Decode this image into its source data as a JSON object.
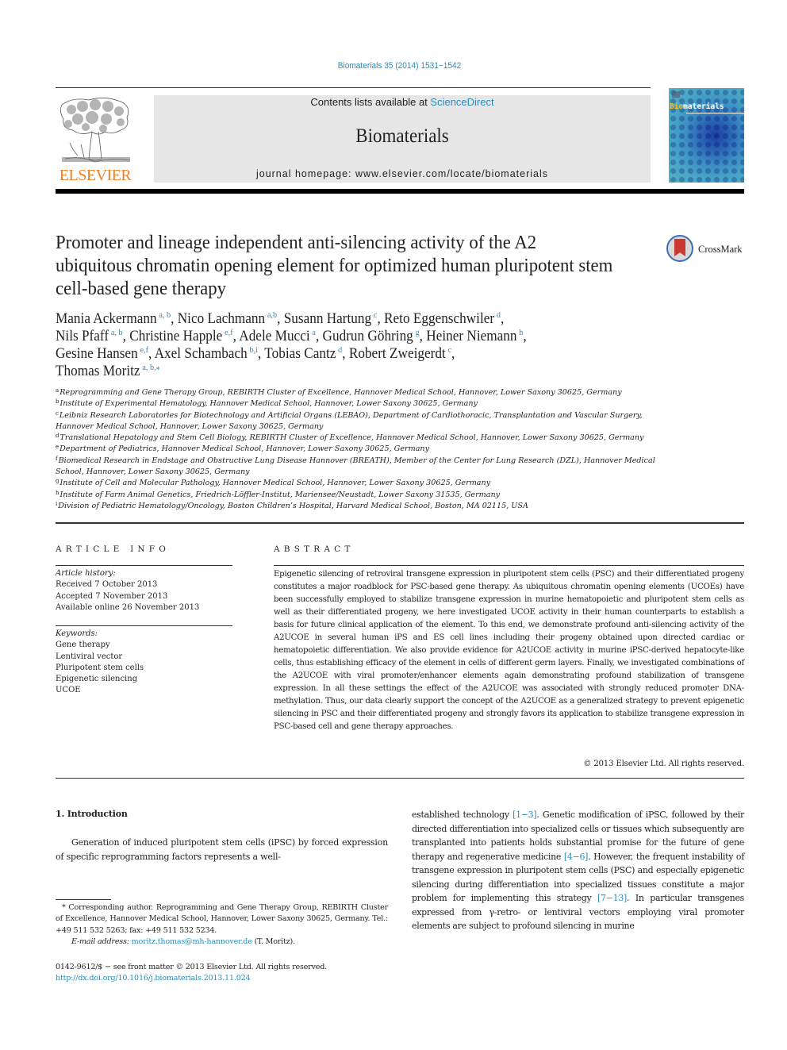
{
  "header": {
    "journal_reference": "Biomaterials 35 (2014) 1531−1542",
    "contents_prefix": "Contents lists available at ",
    "contents_link": "ScienceDirect",
    "journal_title": "Biomaterials",
    "homepage": "journal homepage: www.elsevier.com/locate/biomaterials",
    "publisher_logo_text": "ELSEVIER",
    "cover": {
      "title_highlight": "Bio",
      "title_rest": "materials"
    },
    "colors": {
      "link": "#2a8cba",
      "elsevier_orange": "#f47f20",
      "banner_bg": "#e6e6e6"
    }
  },
  "article": {
    "title": "Promoter and lineage independent anti-silencing activity of the A2 ubiquitous chromatin opening element for optimized human pluripotent stem cell-based gene therapy",
    "crossmark_label": "CrossMark",
    "authors": [
      {
        "name": "Mania Ackermann",
        "affils": "a, b",
        "sep": ", "
      },
      {
        "name": "Nico Lachmann",
        "affils": "a,b",
        "sep": ", "
      },
      {
        "name": "Susann Hartung",
        "affils": "c",
        "sep": ", "
      },
      {
        "name": "Reto Eggenschwiler",
        "affils": "d",
        "sep": ","
      },
      {
        "name": "Nils Pfaff",
        "affils": "a, b",
        "sep": ", "
      },
      {
        "name": "Christine Happle",
        "affils": "e,f",
        "sep": ", "
      },
      {
        "name": "Adele Mucci",
        "affils": "a",
        "sep": ", "
      },
      {
        "name": "Gudrun Göhring",
        "affils": "g",
        "sep": ", "
      },
      {
        "name": "Heiner Niemann",
        "affils": "h",
        "sep": ","
      },
      {
        "name": "Gesine Hansen",
        "affils": "e,f",
        "sep": ", "
      },
      {
        "name": "Axel Schambach",
        "affils": "b,i",
        "sep": ", "
      },
      {
        "name": "Tobias Cantz",
        "affils": "d",
        "sep": ", "
      },
      {
        "name": "Robert Zweigerdt",
        "affils": "c",
        "sep": ","
      },
      {
        "name": "Thomas Moritz",
        "affils": "a, b,⁎",
        "sep": ""
      }
    ],
    "affiliations": [
      {
        "key": "a",
        "text": "Reprogramming and Gene Therapy Group, REBIRTH Cluster of Excellence, Hannover Medical School, Hannover, Lower Saxony 30625, Germany"
      },
      {
        "key": "b",
        "text": "Institute of Experimental Hematology, Hannover Medical School, Hannover, Lower Saxony 30625, Germany"
      },
      {
        "key": "c",
        "text": "Leibniz Research Laboratories for Biotechnology and Artificial Organs (LEBAO), Department of Cardiothoracic, Transplantation and Vascular Surgery, Hannover Medical School, Hannover, Lower Saxony 30625, Germany"
      },
      {
        "key": "d",
        "text": "Translational Hepatology and Stem Cell Biology, REBIRTH Cluster of Excellence, Hannover Medical School, Hannover, Lower Saxony 30625, Germany"
      },
      {
        "key": "e",
        "text": "Department of Pediatrics, Hannover Medical School, Hannover, Lower Saxony 30625, Germany"
      },
      {
        "key": "f",
        "text": "Biomedical Research in Endstage and Obstructive Lung Disease Hannover (BREATH), Member of the Center for Lung Research (DZL), Hannover Medical School, Hannover, Lower Saxony 30625, Germany"
      },
      {
        "key": "g",
        "text": "Institute of Cell and Molecular Pathology, Hannover Medical School, Hannover, Lower Saxony 30625, Germany"
      },
      {
        "key": "h",
        "text": "Institute of Farm Animal Genetics, Friedrich-Löffler-Institut, Mariensee/Neustadt, Lower Saxony 31535, Germany"
      },
      {
        "key": "i",
        "text": "Division of Pediatric Hematology/Oncology, Boston Children’s Hospital, Harvard Medical School, Boston, MA 02115, USA"
      }
    ]
  },
  "article_info": {
    "heading": "ARTICLE INFO",
    "history_label": "Article history:",
    "received": "Received 7 October 2013",
    "accepted": "Accepted 7 November 2013",
    "available": "Available online 26 November 2013",
    "keywords_label": "Keywords:",
    "keywords": [
      "Gene therapy",
      "Lentiviral vector",
      "Pluripotent stem cells",
      "Epigenetic silencing",
      "UCOE"
    ]
  },
  "abstract": {
    "heading": "ABSTRACT",
    "text": "Epigenetic silencing of retroviral transgene expression in pluripotent stem cells (PSC) and their differ­entiated progeny constitutes a major roadblock for PSC-based gene therapy. As ubiquitous chromatin opening elements (UCOEs) have been successfully employed to stabilize transgene expression in murine hematopoietic and pluripotent stem cells as well as their differentiated progeny, we here investigated UCOE activity in their human counterparts to establish a basis for future clinical application of the element. To this end, we demonstrate profound anti-silencing activity of the A2UCOE in several human iPS and ES cell lines including their progeny obtained upon directed cardiac or hematopoietic differ­entiation. We also provide evidence for A2UCOE activity in murine iPSC-derived hepatocyte-like cells, thus establishing efficacy of the element in cells of different germ layers. Finally, we investigated com­binations of the A2UCOE with viral promoter/enhancer elements again demonstrating profound stabi­lization of transgene expression. In all these settings the effect of the A2UCOE was associated with strongly reduced promoter DNA-methylation. Thus, our data clearly support the concept of the A2UCOE as a generalized strategy to prevent epigenetic silencing in PSC and their differentiated progeny and strongly favors its application to stabilize transgene expression in PSC-based cell and gene therapy approaches.",
    "copyright": "© 2013 Elsevier Ltd. All rights reserved."
  },
  "body": {
    "section_heading": "1.  Introduction",
    "left_paragraph": "Generation of induced pluripotent stem cells (iPSC) by forced expression of specific reprogramming factors represents a well-",
    "right_paragraph": [
      {
        "t": "established technology "
      },
      {
        "t": "[1−3]",
        "link": true
      },
      {
        "t": ". Genetic modification of iPSC, fol­lowed by their directed differentiation into specialized cells or tis­sues which subsequently are transplanted into patients holds substantial promise for the future of gene therapy and regenerative medicine "
      },
      {
        "t": "[4−6]",
        "link": true
      },
      {
        "t": ". However, the frequent instability of transgene expression in pluripotent stem cells (PSC) and especially epigenetic silencing during differentiation into specialized tissues constitute a major problem for implementing this strategy "
      },
      {
        "t": "[7−13]",
        "link": true
      },
      {
        "t": ". In particular transgenes expressed from γ-retro- or lentiviral vectors employing viral promoter elements are subject to profound silencing in murine"
      }
    ]
  },
  "footnotes": {
    "corresponding": "* Corresponding author. Reprogramming and Gene Therapy Group, REBIRTH Cluster of Excellence, Hannover Medical School, Hannover, Lower Saxony 30625, Germany. Tel.: +49 511 532 5263; fax: +49 511 532 5234.",
    "email_label": "E-mail address:",
    "email": "moritz.thomas@mh-hannover.de",
    "email_suffix": " (T. Moritz).",
    "issn": "0142-9612/$ − see front matter © 2013 Elsevier Ltd. All rights reserved.",
    "doi": "http://dx.doi.org/10.1016/j.biomaterials.2013.11.024"
  }
}
